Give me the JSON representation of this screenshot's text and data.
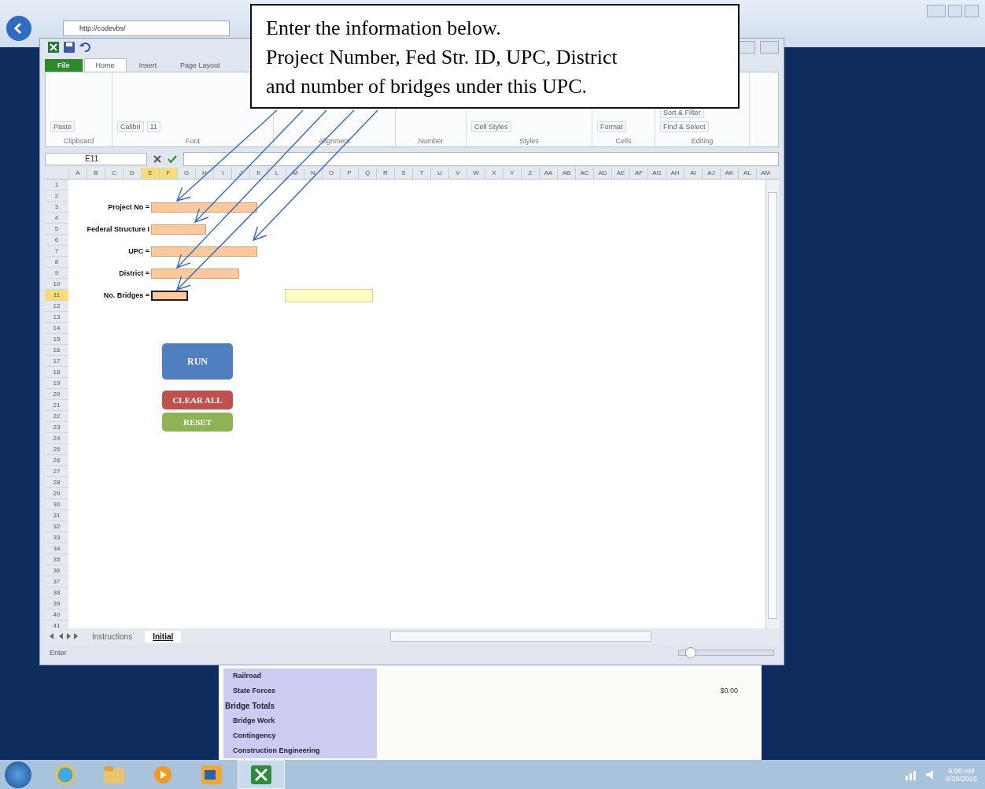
{
  "browser": {
    "address": "http://codevbs/"
  },
  "callout": {
    "text": "Enter the information below.\nProject Number, Fed Str. ID, UPC, District\nand number of bridges under this UPC."
  },
  "excel": {
    "ribbon_tabs": [
      {
        "label": "File",
        "kind": "file",
        "selected": false
      },
      {
        "label": "Home",
        "kind": "tab",
        "selected": true
      },
      {
        "label": "Insert",
        "kind": "tab",
        "selected": false
      },
      {
        "label": "Page Layout",
        "kind": "tab",
        "selected": false
      }
    ],
    "ribbon_groups": [
      {
        "label": "Clipboard",
        "buttons": [
          "Paste"
        ]
      },
      {
        "label": "Font",
        "buttons": [
          "Calibri",
          "11"
        ]
      },
      {
        "label": "Alignment"
      },
      {
        "label": "Number"
      },
      {
        "label": "Styles",
        "buttons": [
          "Cell Styles"
        ]
      },
      {
        "label": "Cells",
        "buttons": [
          "Format"
        ]
      },
      {
        "label": "Editing",
        "buttons": [
          "Sort & Filter",
          "Find & Select"
        ]
      }
    ],
    "name_box": "E11",
    "columns": [
      {
        "label": "A",
        "selected": false
      },
      {
        "label": "B",
        "selected": false
      },
      {
        "label": "C",
        "selected": false
      },
      {
        "label": "D",
        "selected": false
      },
      {
        "label": "E",
        "selected": true
      },
      {
        "label": "F",
        "selected": true
      },
      {
        "label": "G",
        "selected": false
      },
      {
        "label": "H",
        "selected": false
      },
      {
        "label": "I",
        "selected": false
      },
      {
        "label": "J",
        "selected": false
      },
      {
        "label": "K",
        "selected": false
      },
      {
        "label": "L",
        "selected": false
      },
      {
        "label": "M",
        "selected": false
      },
      {
        "label": "N",
        "selected": false
      },
      {
        "label": "O",
        "selected": false
      },
      {
        "label": "P",
        "selected": false
      },
      {
        "label": "Q",
        "selected": false
      },
      {
        "label": "R",
        "selected": false
      },
      {
        "label": "S",
        "selected": false
      },
      {
        "label": "T",
        "selected": false
      },
      {
        "label": "U",
        "selected": false
      },
      {
        "label": "V",
        "selected": false
      },
      {
        "label": "W",
        "selected": false
      },
      {
        "label": "X",
        "selected": false
      },
      {
        "label": "Y",
        "selected": false
      },
      {
        "label": "Z",
        "selected": false
      },
      {
        "label": "AA",
        "selected": false
      },
      {
        "label": "AB",
        "selected": false
      },
      {
        "label": "AC",
        "selected": false
      },
      {
        "label": "AD",
        "selected": false
      },
      {
        "label": "AE",
        "selected": false
      },
      {
        "label": "AF",
        "selected": false
      },
      {
        "label": "AG",
        "selected": false
      },
      {
        "label": "AH",
        "selected": false
      },
      {
        "label": "AI",
        "selected": false
      },
      {
        "label": "AJ",
        "selected": false
      },
      {
        "label": "AK",
        "selected": false
      },
      {
        "label": "AL",
        "selected": false
      },
      {
        "label": "AM",
        "selected": false
      }
    ],
    "rows": [
      {
        "label": "1",
        "selected": false
      },
      {
        "label": "2",
        "selected": false
      },
      {
        "label": "3",
        "selected": false
      },
      {
        "label": "4",
        "selected": false
      },
      {
        "label": "5",
        "selected": false
      },
      {
        "label": "6",
        "selected": false
      },
      {
        "label": "7",
        "selected": false
      },
      {
        "label": "8",
        "selected": false
      },
      {
        "label": "9",
        "selected": false
      },
      {
        "label": "10",
        "selected": false
      },
      {
        "label": "11",
        "selected": true
      },
      {
        "label": "12",
        "selected": false
      },
      {
        "label": "13",
        "selected": false
      },
      {
        "label": "14",
        "selected": false
      },
      {
        "label": "15",
        "selected": false
      },
      {
        "label": "16",
        "selected": false
      },
      {
        "label": "17",
        "selected": false
      },
      {
        "label": "18",
        "selected": false
      },
      {
        "label": "19",
        "selected": false
      },
      {
        "label": "20",
        "selected": false
      },
      {
        "label": "21",
        "selected": false
      },
      {
        "label": "22",
        "selected": false
      },
      {
        "label": "23",
        "selected": false
      },
      {
        "label": "24",
        "selected": false
      },
      {
        "label": "25",
        "selected": false
      },
      {
        "label": "26",
        "selected": false
      },
      {
        "label": "27",
        "selected": false
      },
      {
        "label": "28",
        "selected": false
      },
      {
        "label": "29",
        "selected": false
      },
      {
        "label": "30",
        "selected": false
      },
      {
        "label": "31",
        "selected": false
      },
      {
        "label": "32",
        "selected": false
      },
      {
        "label": "33",
        "selected": false
      },
      {
        "label": "34",
        "selected": false
      },
      {
        "label": "35",
        "selected": false
      },
      {
        "label": "36",
        "selected": false
      },
      {
        "label": "37",
        "selected": false
      },
      {
        "label": "38",
        "selected": false
      },
      {
        "label": "39",
        "selected": false
      },
      {
        "label": "40",
        "selected": false
      },
      {
        "label": "41",
        "selected": false
      }
    ],
    "form": [
      {
        "label": "Project No =",
        "selected": false
      },
      {
        "label": "Federal Structure I",
        "selected": false
      },
      {
        "label": "UPC =",
        "selected": false
      },
      {
        "label": "District =",
        "selected": false
      },
      {
        "label": "No. Bridges =",
        "selected": true
      }
    ],
    "buttons": [
      {
        "label": "RUN",
        "kind": "run"
      },
      {
        "label": "CLEAR ALL",
        "kind": "clear"
      },
      {
        "label": "RESET",
        "kind": "reset"
      }
    ],
    "sheet_tabs": [
      {
        "label": "Instructions",
        "selected": false
      },
      {
        "label": "Initial",
        "selected": true
      }
    ],
    "status": "Enter",
    "zoom_slider": {
      "level": 0.12
    }
  },
  "background_sheet": {
    "rows": [
      {
        "label": "Railroad",
        "kind": "item"
      },
      {
        "label": "State Forces",
        "kind": "item",
        "value": "$0.00"
      },
      {
        "label": "Bridge Totals",
        "kind": "heading"
      },
      {
        "label": "Bridge Work",
        "kind": "item"
      },
      {
        "label": "Contingency",
        "kind": "item"
      },
      {
        "label": "Construction Engineering",
        "kind": "item"
      }
    ]
  },
  "taskbar": {
    "time": "9:00 AM",
    "date": "6/29/2015"
  }
}
